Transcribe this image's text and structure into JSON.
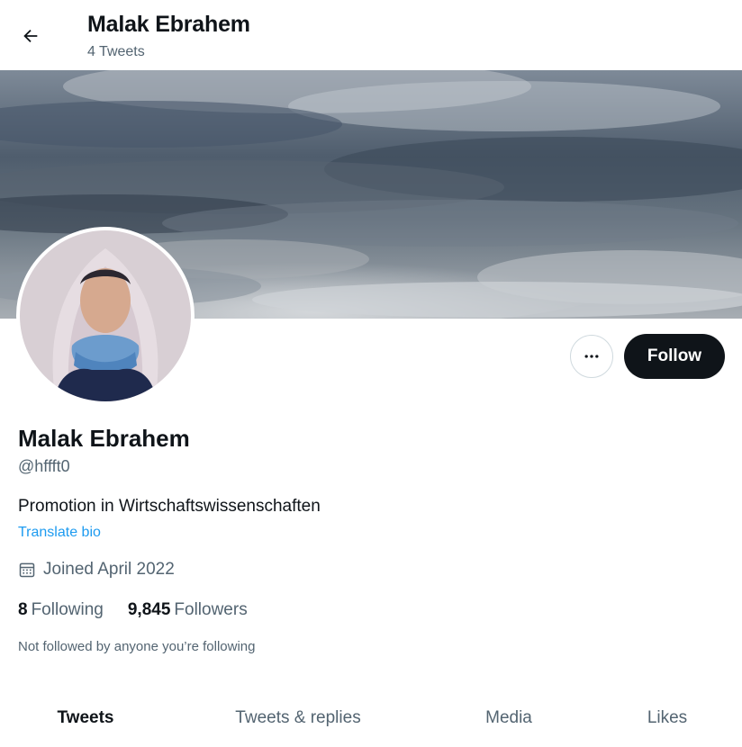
{
  "header": {
    "back_icon": "arrow-left-icon",
    "title": "Malak Ebrahem",
    "subtitle": "4 Tweets"
  },
  "profile": {
    "name": "Malak Ebrahem",
    "handle": "@hffft0",
    "bio": "Promotion in Wirtschaftswissenschaften",
    "translate_bio": "Translate bio",
    "joined": "Joined April 2022",
    "following_count": "8",
    "following_label": "Following",
    "followers_count": "9,845",
    "followers_label": "Followers",
    "not_followed": "Not followed by anyone you’re following"
  },
  "actions": {
    "more_icon": "more-horizontal-icon",
    "follow_label": "Follow"
  },
  "tabs": [
    {
      "label": "Tweets",
      "active": true
    },
    {
      "label": "Tweets & replies",
      "active": false
    },
    {
      "label": "Media",
      "active": false
    },
    {
      "label": "Likes",
      "active": false
    }
  ],
  "colors": {
    "text_primary": "#0f1419",
    "text_secondary": "#536471",
    "link": "#1d9bf0",
    "follow_button_bg": "#0f1419"
  }
}
